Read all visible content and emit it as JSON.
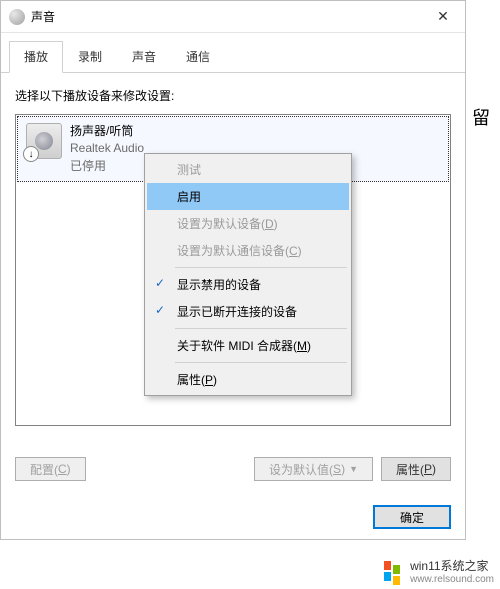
{
  "titlebar": {
    "title": "声音"
  },
  "tabs": {
    "playback": "播放",
    "record": "录制",
    "sound": "声音",
    "comm": "通信"
  },
  "content": {
    "instruction": "选择以下播放设备来修改设置:"
  },
  "device": {
    "name": "扬声器/听筒",
    "driver": "Realtek Audio",
    "status": "已停用",
    "badge": "↓"
  },
  "context_menu": {
    "test": "测试",
    "enable": "启用",
    "set_default_prefix": "设置为默认设备(",
    "set_default_key": "D",
    "close_paren": ")",
    "set_comm_prefix": "设置为默认通信设备(",
    "set_comm_key": "C",
    "show_disabled": "显示禁用的设备",
    "show_disconnected": "显示已断开连接的设备",
    "about_midi_prefix": "关于软件 MIDI 合成器(",
    "about_midi_key": "M",
    "properties_prefix": "属性(",
    "properties_key": "P"
  },
  "buttons": {
    "configure_prefix": "配置(",
    "configure_key": "C",
    "close_paren": ")",
    "set_default_prefix": "设为默认值(",
    "set_default_key": "S",
    "arrow": "▼",
    "properties_prefix": "属性(",
    "properties_key": "P",
    "ok": "确定"
  },
  "watermark": {
    "text1": "win11系统之家",
    "text2": "www.relsound.com"
  },
  "side_char": "留"
}
